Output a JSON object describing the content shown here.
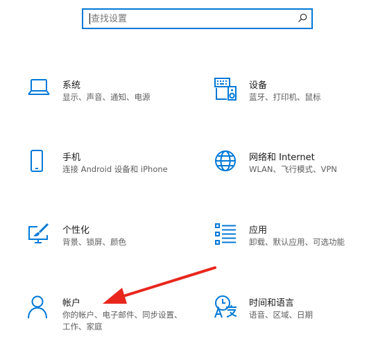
{
  "search": {
    "placeholder": "查找设置"
  },
  "colors": {
    "accent": "#0078d7",
    "arrow": "#e8261c"
  },
  "tiles": [
    {
      "id": "system",
      "icon": "laptop-icon",
      "title": "系统",
      "description": "显示、声音、通知、电源"
    },
    {
      "id": "devices",
      "icon": "keyboard-speaker-icon",
      "title": "设备",
      "description": "蓝牙、打印机、鼠标"
    },
    {
      "id": "phone",
      "icon": "phone-icon",
      "title": "手机",
      "description": "连接 Android 设备和 iPhone"
    },
    {
      "id": "network",
      "icon": "globe-icon",
      "title": "网络和 Internet",
      "description": "WLAN、飞行模式、VPN"
    },
    {
      "id": "personalization",
      "icon": "paint-monitor-icon",
      "title": "个性化",
      "description": "背景、锁屏、颜色"
    },
    {
      "id": "apps",
      "icon": "app-list-icon",
      "title": "应用",
      "description": "卸载、默认应用、可选功能"
    },
    {
      "id": "accounts",
      "icon": "person-icon",
      "title": "帐户",
      "description": "你的帐户、电子邮件、同步设置、工作、家庭"
    },
    {
      "id": "time-language",
      "icon": "time-language-icon",
      "title": "时间和语言",
      "description": "语音、区域、日期"
    }
  ]
}
